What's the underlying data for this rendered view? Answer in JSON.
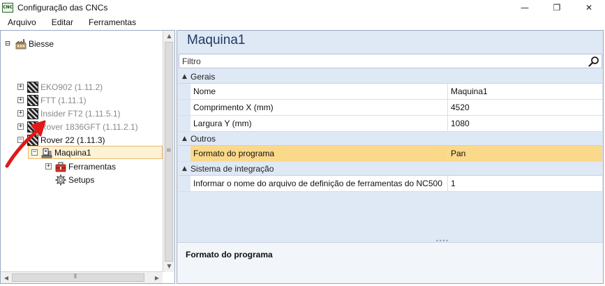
{
  "window": {
    "app_icon_text": "CNC",
    "title": "Configuração das CNCs",
    "minimize": "—",
    "maximize": "❐",
    "close": "✕"
  },
  "menu": [
    "Arquivo",
    "Editar",
    "Ferramentas"
  ],
  "tree": {
    "root": {
      "label": "Biesse",
      "expander": "⊟"
    },
    "machines": [
      {
        "label": "EKO902 (1.11.2)",
        "expander": "+",
        "dim": true
      },
      {
        "label": "FTT (1.11.1)",
        "expander": "+",
        "dim": true
      },
      {
        "label": "Insider FT2 (1.11.5.1)",
        "expander": "+",
        "dim": true
      },
      {
        "label": "Rover 1836GFT (1.11.2.1)",
        "expander": "+",
        "dim": true
      },
      {
        "label": "Rover 22 (1.11.3)",
        "expander": "−",
        "dim": false
      }
    ],
    "selected": {
      "label": "Maquina1",
      "expander": "−"
    },
    "children": [
      {
        "label": "Ferramentas",
        "expander": "+"
      },
      {
        "label": "Setups"
      }
    ]
  },
  "properties": {
    "title": "Maquina1",
    "filter_placeholder": "Filtro",
    "categories": [
      {
        "label": "Gerais",
        "toggle": "▲",
        "rows": [
          {
            "name": "Nome",
            "value": "Maquina1"
          },
          {
            "name": "Comprimento X (mm)",
            "value": "4520"
          },
          {
            "name": "Largura Y (mm)",
            "value": "1080"
          }
        ]
      },
      {
        "label": "Outros",
        "toggle": "▲",
        "rows": [
          {
            "name": "Formato do programa",
            "value": "Pan",
            "highlight": true
          }
        ]
      },
      {
        "label": "Sistema de integração",
        "toggle": "▲",
        "rows": [
          {
            "name": "Informar o nome do arquivo de definição de ferramentas do NC500",
            "value": "1"
          }
        ]
      }
    ],
    "description_title": "Formato do programa"
  },
  "colors": {
    "accent_arrow": "#e01818",
    "selection_highlight": "#fbd98a",
    "panel_background": "#dfe8f5",
    "title_text": "#1f3a63"
  }
}
